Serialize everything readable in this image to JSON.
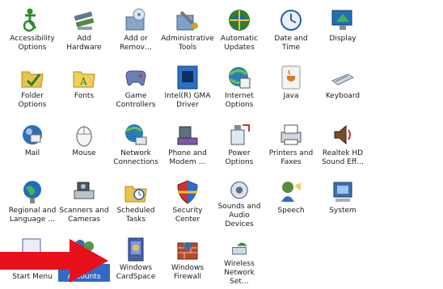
{
  "items": [
    {
      "label": "Accessibility\nOptions",
      "icon": "accessibility-icon"
    },
    {
      "label": "Add Hardware",
      "icon": "add-hardware-icon"
    },
    {
      "label": "Add or\nRemov…",
      "icon": "add-remove-programs-icon"
    },
    {
      "label": "Administrative\nTools",
      "icon": "administrative-tools-icon"
    },
    {
      "label": "Automatic\nUpdates",
      "icon": "automatic-updates-icon"
    },
    {
      "label": "Date and Time",
      "icon": "date-time-icon"
    },
    {
      "label": "Display",
      "icon": "display-icon"
    },
    {
      "label": "Folder Options",
      "icon": "folder-options-icon"
    },
    {
      "label": "Fonts",
      "icon": "fonts-folder-icon"
    },
    {
      "label": "Game\nControllers",
      "icon": "game-controller-icon"
    },
    {
      "label": "Intel(R) GMA\nDriver",
      "icon": "intel-gma-icon"
    },
    {
      "label": "Internet\nOptions",
      "icon": "internet-options-icon"
    },
    {
      "label": "Java",
      "icon": "java-icon"
    },
    {
      "label": "Keyboard",
      "icon": "keyboard-icon"
    },
    {
      "label": "Mail",
      "icon": "mail-icon"
    },
    {
      "label": "Mouse",
      "icon": "mouse-icon"
    },
    {
      "label": "Network\nConnections",
      "icon": "network-connections-icon"
    },
    {
      "label": "Phone and\nModem …",
      "icon": "phone-modem-icon"
    },
    {
      "label": "Power Options",
      "icon": "power-options-icon"
    },
    {
      "label": "Printers and\nFaxes",
      "icon": "printers-faxes-icon"
    },
    {
      "label": "Realtek HD\nSound Eff…",
      "icon": "speaker-icon"
    },
    {
      "label": "Regional and\nLanguage …",
      "icon": "globe-icon"
    },
    {
      "label": "Scanners and\nCameras",
      "icon": "scanner-camera-icon"
    },
    {
      "label": "Scheduled\nTasks",
      "icon": "scheduled-tasks-icon"
    },
    {
      "label": "Security\nCenter",
      "icon": "security-shield-icon"
    },
    {
      "label": "Sounds and\nAudio Devices",
      "icon": "sounds-audio-icon"
    },
    {
      "label": "Speech",
      "icon": "speech-icon"
    },
    {
      "label": "System",
      "icon": "system-icon"
    },
    {
      "label": "Taskbar and\nStart Menu",
      "icon": "taskbar-icon"
    },
    {
      "label": "User Accounts",
      "icon": "user-accounts-icon",
      "selected": true
    },
    {
      "label": "Windows\nCardSpace",
      "icon": "cardspace-icon"
    },
    {
      "label": "Windows\nFirewall",
      "icon": "firewall-icon"
    },
    {
      "label": "Wireless\nNetwork Set…",
      "icon": "wireless-network-icon"
    }
  ],
  "arrow": {
    "color": "#e8101a",
    "icon": "red-arrow-icon"
  },
  "selection_color": "#316ac5"
}
